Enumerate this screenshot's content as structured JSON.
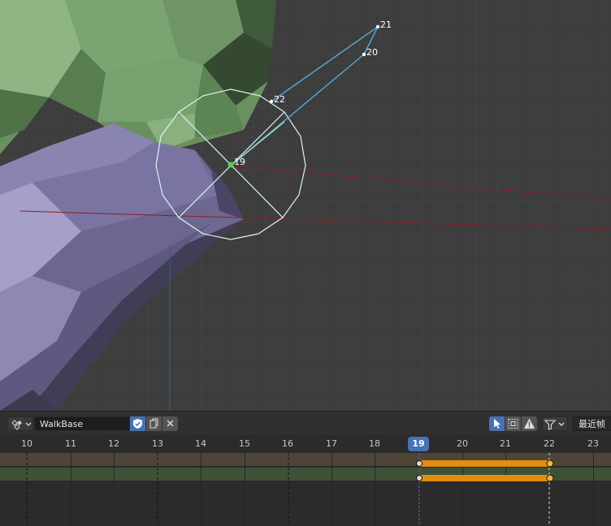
{
  "viewport": {
    "bone_labels": {
      "b19": "19",
      "b20": "20",
      "b21": "21",
      "b22": "22"
    }
  },
  "dopesheet": {
    "header": {
      "action_name": "WalkBase",
      "snapping_label": "最近帧"
    },
    "ruler": {
      "frames": [
        "10",
        "11",
        "12",
        "13",
        "14",
        "15",
        "16",
        "17",
        "18",
        "19",
        "20",
        "21",
        "22",
        "23"
      ],
      "current_frame": "19"
    },
    "colors": {
      "accent": "#4772b3",
      "keyframe_selected": "#e38d10",
      "summary_row": "#4e4536",
      "object_row": "#3d5136"
    }
  }
}
